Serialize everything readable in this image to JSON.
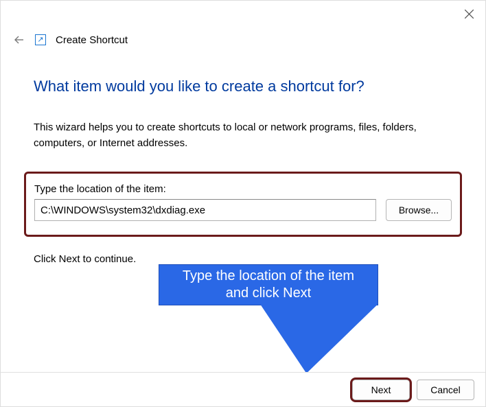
{
  "window": {
    "wizard_title": "Create Shortcut"
  },
  "main": {
    "headline": "What item would you like to create a shortcut for?",
    "description": "This wizard helps you to create shortcuts to local or network programs, files, folders, computers, or Internet addresses.",
    "location_label": "Type the location of the item:",
    "location_value": "C:\\WINDOWS\\system32\\dxdiag.exe",
    "browse_label": "Browse...",
    "continue_hint": "Click Next to continue."
  },
  "callout": {
    "line1": "Type the location of the item",
    "line2": "and click Next"
  },
  "footer": {
    "next_label": "Next",
    "cancel_label": "Cancel"
  }
}
